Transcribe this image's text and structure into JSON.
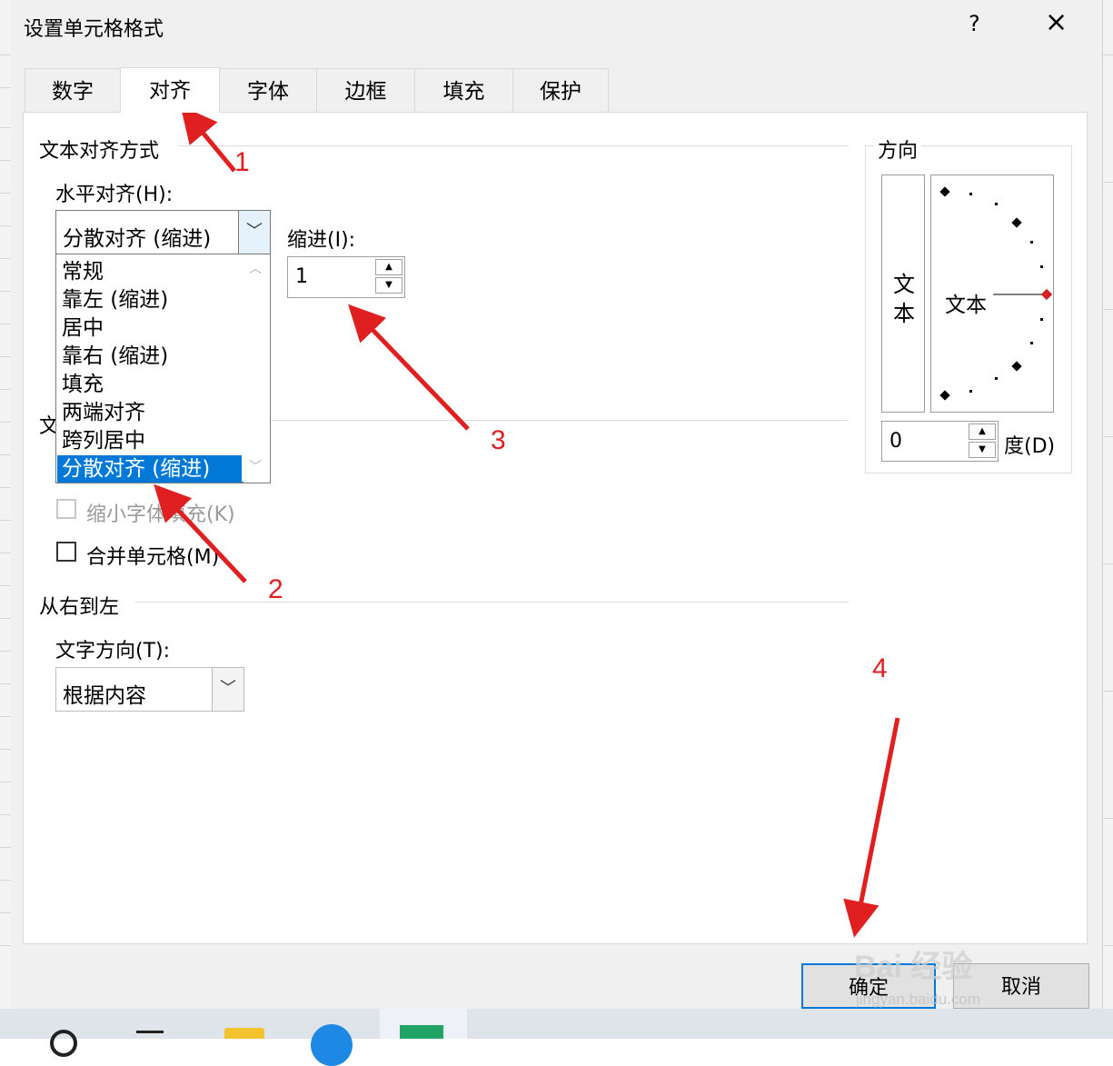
{
  "dialog": {
    "title": "设置单元格格式",
    "help": "?",
    "close": "×"
  },
  "tabs": [
    "数字",
    "对齐",
    "字体",
    "边框",
    "填充",
    "保护"
  ],
  "active_tab": "对齐",
  "text_alignment": {
    "section": "文本对齐方式",
    "horizontal_label": "水平对齐(H):",
    "horizontal_value": "分散对齐 (缩进)",
    "horizontal_options": [
      "常规",
      "靠左 (缩进)",
      "居中",
      "靠右 (缩进)",
      "填充",
      "两端对齐",
      "跨列居中",
      "分散对齐 (缩进)"
    ],
    "indent_label": "缩进(I):",
    "indent_value": "1"
  },
  "text_control": {
    "section_partial": "文",
    "shrink_label": "缩小字体填充(K)",
    "merge_label": "合并单元格(M)"
  },
  "rtl": {
    "section": "从右到左",
    "direction_label": "文字方向(T):",
    "direction_value": "根据内容"
  },
  "orientation": {
    "section": "方向",
    "vertical_text": [
      "文",
      "本"
    ],
    "dial_text": "文本",
    "degree_value": "0",
    "degree_label": "度(D)"
  },
  "buttons": {
    "ok": "确定",
    "cancel": "取消"
  },
  "annotations": [
    "1",
    "2",
    "3",
    "4"
  ],
  "watermark": {
    "brand": "Bai 经验",
    "url": "jingyan.baidu.com"
  },
  "colors": {
    "accent": "#0078d7",
    "annotation": "#e02020"
  }
}
